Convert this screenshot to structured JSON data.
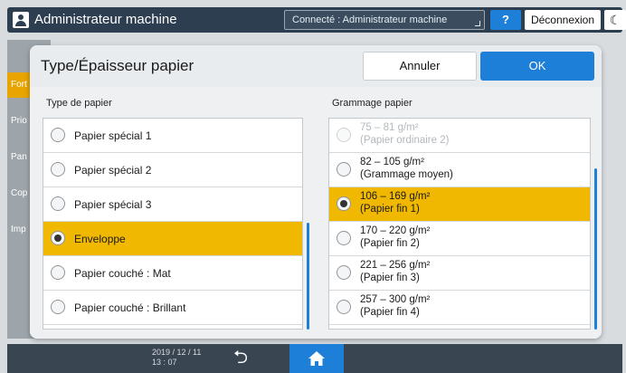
{
  "topbar": {
    "title": "Administrateur machine",
    "status": "Connecté : Administrateur machine",
    "help_label": "?",
    "logout_label": "Déconnexion",
    "moon_label": "☾"
  },
  "background_menu": {
    "items": [
      "Fort",
      "Prio",
      "Pan",
      "Cop",
      "Imp"
    ]
  },
  "dialog": {
    "title": "Type/Épaisseur papier",
    "cancel_label": "Annuler",
    "ok_label": "OK",
    "paper_type": {
      "heading": "Type de papier",
      "items": [
        {
          "label": "Papier spécial 1",
          "selected": false
        },
        {
          "label": "Papier spécial 2",
          "selected": false
        },
        {
          "label": "Papier spécial 3",
          "selected": false
        },
        {
          "label": "Enveloppe",
          "selected": true
        },
        {
          "label": "Papier couché : Mat",
          "selected": false
        },
        {
          "label": "Papier couché : Brillant",
          "selected": false
        }
      ]
    },
    "paper_weight": {
      "heading": "Grammage papier",
      "items": [
        {
          "line1": "75 – 81 g/m²",
          "line2": "(Papier ordinaire 2)",
          "selected": false,
          "disabled": true
        },
        {
          "line1": "82 – 105 g/m²",
          "line2": "(Grammage moyen)",
          "selected": false,
          "disabled": false
        },
        {
          "line1": "106 – 169 g/m²",
          "line2": "(Papier fin 1)",
          "selected": true,
          "disabled": false
        },
        {
          "line1": "170 – 220 g/m²",
          "line2": "(Papier fin 2)",
          "selected": false,
          "disabled": false
        },
        {
          "line1": "221 – 256 g/m²",
          "line2": "(Papier fin 3)",
          "selected": false,
          "disabled": false
        },
        {
          "line1": "257 – 300 g/m²",
          "line2": "(Papier fin 4)",
          "selected": false,
          "disabled": false
        }
      ]
    }
  },
  "bottombar": {
    "date": "2019 / 12 / 11",
    "time": "13 : 07",
    "back_label": "⮌"
  },
  "colors": {
    "accent": "#1e7fd8",
    "selected": "#f0b800",
    "topbar": "#2c3e50"
  }
}
